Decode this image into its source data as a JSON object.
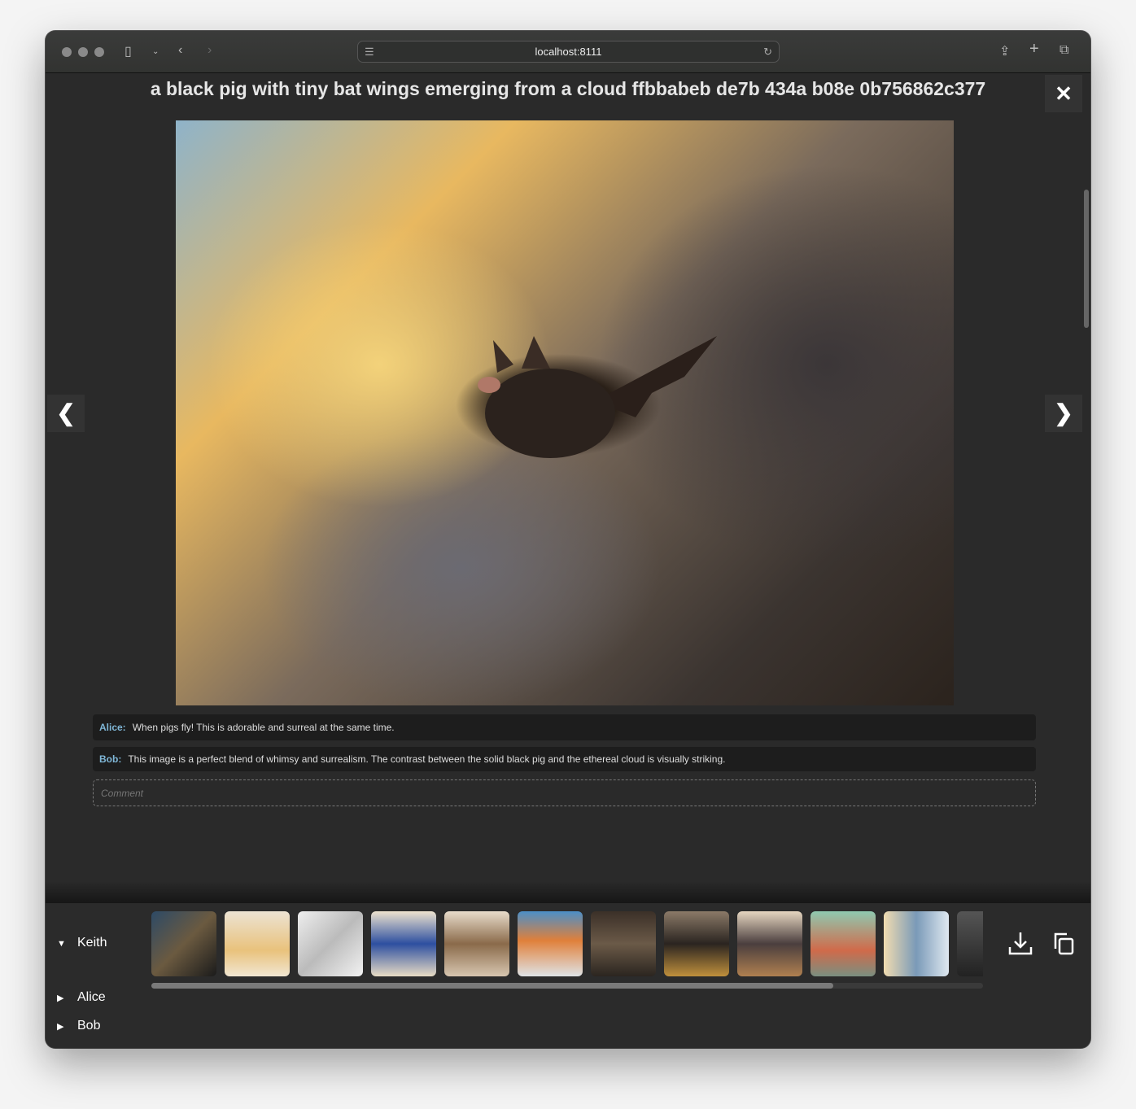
{
  "browser": {
    "url": "localhost:8111"
  },
  "viewer": {
    "title": "a black pig with tiny bat wings emerging from a cloud ffbbabeb de7b 434a b08e 0b756862c377",
    "close_label": "✕",
    "prev_label": "❮",
    "next_label": "❯",
    "comments": [
      {
        "author": "Alice:",
        "text": "When pigs fly! This is adorable and surreal at the same time."
      },
      {
        "author": "Bob:",
        "text": "This image is a perfect blend of whimsy and surrealism. The contrast between the solid black pig and the ethereal cloud is visually striking."
      }
    ],
    "comment_placeholder": "Comment"
  },
  "users": [
    {
      "name": "Keith",
      "expanded": true
    },
    {
      "name": "Alice",
      "expanded": false
    },
    {
      "name": "Bob",
      "expanded": false
    }
  ],
  "gallery": {
    "scroll_fraction": 0.82,
    "thumbnails": [
      "film-set",
      "cloud-balloons",
      "white-fabric",
      "blue-clock-house",
      "man-tv-head",
      "clownfish-beach",
      "caveman-tv",
      "bat-pig-cloud",
      "robot-roosters",
      "hazmat-vacuum",
      "cloud-room",
      "retro-tv"
    ]
  },
  "colors": {
    "accent": "#7fb6d6",
    "background": "#2a2a2a"
  }
}
